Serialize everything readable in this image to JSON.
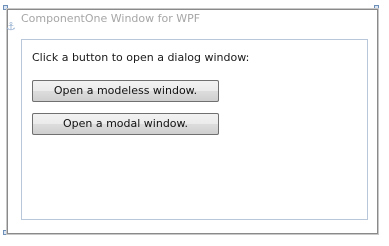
{
  "window": {
    "title": "ComponentOne Window for WPF"
  },
  "content": {
    "instruction": "Click a button to open a dialog window:",
    "buttons": [
      {
        "label": "Open a modeless window."
      },
      {
        "label": "Open a modal window."
      }
    ]
  },
  "icons": {
    "anchor": "anchor-icon",
    "resize_handle": "resize-handle-icon"
  },
  "colors": {
    "title_text": "#a6a6a6",
    "panel_border": "#b9c7da",
    "frame_border": "#8a8a8a"
  }
}
